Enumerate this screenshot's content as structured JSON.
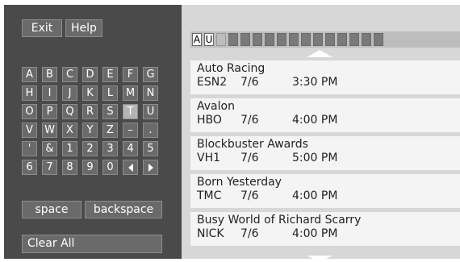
{
  "buttons": {
    "exit": "Exit",
    "help": "Help"
  },
  "keyboard": {
    "rows": [
      [
        "A",
        "B",
        "C",
        "D",
        "E",
        "F",
        "G"
      ],
      [
        "H",
        "I",
        "J",
        "K",
        "L",
        "M",
        "N"
      ],
      [
        "O",
        "P",
        "Q",
        "R",
        "S",
        "T",
        "U"
      ],
      [
        "V",
        "W",
        "X",
        "Y",
        "Z",
        "–",
        "."
      ],
      [
        "'",
        "&",
        "1",
        "2",
        "3",
        "4",
        "5"
      ],
      [
        "6",
        "7",
        "8",
        "9",
        "0",
        "◀",
        "▶"
      ]
    ],
    "selected": "T",
    "space": "space",
    "backspace": "backspace",
    "clear_all": "Clear All"
  },
  "search": {
    "chars": [
      "A",
      "U"
    ],
    "total_cells": 16
  },
  "results": [
    {
      "title": "Auto Racing",
      "channel": "ESN2",
      "date": "7/6",
      "time": "3:30 PM"
    },
    {
      "title": "Avalon",
      "channel": "HBO",
      "date": "7/6",
      "time": "4:00 PM"
    },
    {
      "title": "Blockbuster Awards",
      "channel": "VH1",
      "date": "7/6",
      "time": "5:00 PM"
    },
    {
      "title": "Born Yesterday",
      "channel": "TMC",
      "date": "7/6",
      "time": "4:00 PM"
    },
    {
      "title": "Busy World of Richard Scarry",
      "channel": "NICK",
      "date": "7/6",
      "time": "4:00 PM"
    }
  ],
  "colors": {
    "panel_dark": "#4a4a4a",
    "panel_light": "#d7d7d7",
    "key": "#6a6a6a",
    "key_selected": "#b4b4b4"
  }
}
